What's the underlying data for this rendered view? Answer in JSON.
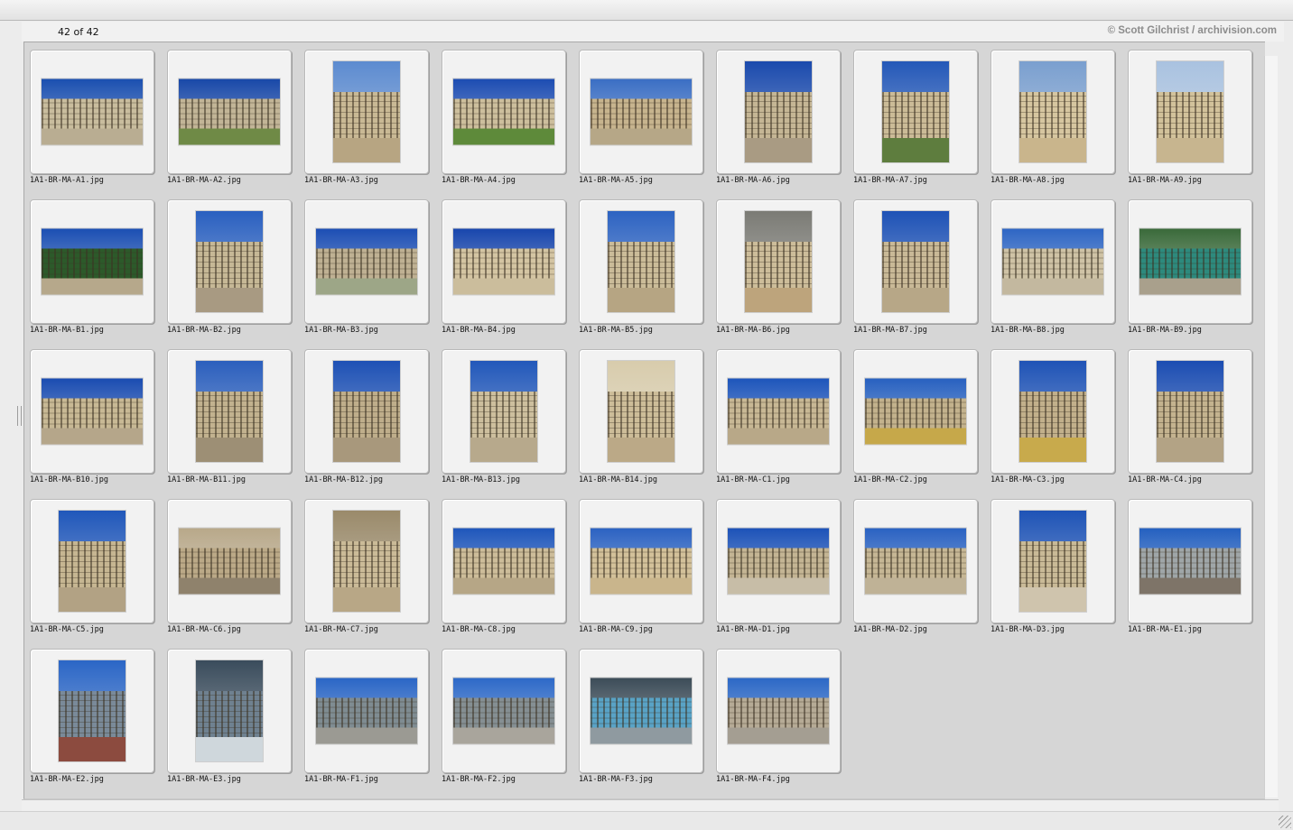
{
  "header": {
    "count_label": "42 of 42",
    "credit": "© Scott Gilchrist / archivision.com"
  },
  "files": [
    {
      "name": "1A1-BR-MA-A1.jpg",
      "orientation": "landscape",
      "palette": {
        "sky": "#1a4fb0",
        "building": "#c9bd9e",
        "ground": "#b9ad92"
      }
    },
    {
      "name": "1A1-BR-MA-A2.jpg",
      "orientation": "landscape",
      "palette": {
        "sky": "#1848a8",
        "building": "#c2b597",
        "ground": "#6f8a46"
      }
    },
    {
      "name": "1A1-BR-MA-A3.jpg",
      "orientation": "portrait",
      "palette": {
        "sky": "#5c8bd0",
        "building": "#c9b995",
        "ground": "#b7a582"
      }
    },
    {
      "name": "1A1-BR-MA-A4.jpg",
      "orientation": "landscape",
      "palette": {
        "sky": "#1c4cb2",
        "building": "#cdbf9d",
        "ground": "#5e8a3a"
      }
    },
    {
      "name": "1A1-BR-MA-A5.jpg",
      "orientation": "landscape",
      "palette": {
        "sky": "#3a6ec4",
        "building": "#c7b48e",
        "ground": "#b6a787"
      }
    },
    {
      "name": "1A1-BR-MA-A6.jpg",
      "orientation": "portrait",
      "palette": {
        "sky": "#1a4aad",
        "building": "#c5b695",
        "ground": "#a99b83"
      }
    },
    {
      "name": "1A1-BR-MA-A7.jpg",
      "orientation": "portrait",
      "palette": {
        "sky": "#2458b8",
        "building": "#cbbb97",
        "ground": "#5e7d3e"
      }
    },
    {
      "name": "1A1-BR-MA-A8.jpg",
      "orientation": "portrait",
      "palette": {
        "sky": "#7a9fcf",
        "building": "#d6c6a0",
        "ground": "#c9b58c"
      }
    },
    {
      "name": "1A1-BR-MA-A9.jpg",
      "orientation": "portrait",
      "palette": {
        "sky": "#a9c2e0",
        "building": "#d2c29b",
        "ground": "#c7b58f"
      }
    },
    {
      "name": "1A1-BR-MA-B1.jpg",
      "orientation": "landscape",
      "palette": {
        "sky": "#1b4fb3",
        "building": "#2c5a2a",
        "ground": "#b6a88b"
      }
    },
    {
      "name": "1A1-BR-MA-B2.jpg",
      "orientation": "portrait",
      "palette": {
        "sky": "#2a60c0",
        "building": "#c6b896",
        "ground": "#a89a82"
      }
    },
    {
      "name": "1A1-BR-MA-B3.jpg",
      "orientation": "landscape",
      "palette": {
        "sky": "#1c4eb4",
        "building": "#bfb193",
        "ground": "#9da687"
      }
    },
    {
      "name": "1A1-BR-MA-B4.jpg",
      "orientation": "landscape",
      "palette": {
        "sky": "#1846ad",
        "building": "#d4c5a3",
        "ground": "#cbbd9c"
      }
    },
    {
      "name": "1A1-BR-MA-B5.jpg",
      "orientation": "portrait",
      "palette": {
        "sky": "#2d63c2",
        "building": "#cbbc99",
        "ground": "#b6a583"
      }
    },
    {
      "name": "1A1-BR-MA-B6.jpg",
      "orientation": "portrait",
      "palette": {
        "sky": "#7b7b75",
        "building": "#cdbd9a",
        "ground": "#bda47c"
      }
    },
    {
      "name": "1A1-BR-MA-B7.jpg",
      "orientation": "portrait",
      "palette": {
        "sky": "#1e52b6",
        "building": "#c9b997",
        "ground": "#b7a787"
      }
    },
    {
      "name": "1A1-BR-MA-B8.jpg",
      "orientation": "landscape",
      "palette": {
        "sky": "#2e66c4",
        "building": "#cfc3a6",
        "ground": "#c3b89f"
      }
    },
    {
      "name": "1A1-BR-MA-B9.jpg",
      "orientation": "landscape",
      "palette": {
        "sky": "#3a6a3a",
        "building": "#2d8a7d",
        "ground": "#a9a08c"
      }
    },
    {
      "name": "1A1-BR-MA-B10.jpg",
      "orientation": "landscape",
      "palette": {
        "sky": "#1a4cb1",
        "building": "#c8b995",
        "ground": "#b5a68a"
      }
    },
    {
      "name": "1A1-BR-MA-B11.jpg",
      "orientation": "portrait",
      "palette": {
        "sky": "#2b5fbd",
        "building": "#c2b28f",
        "ground": "#9d8f75"
      }
    },
    {
      "name": "1A1-BR-MA-B12.jpg",
      "orientation": "portrait",
      "palette": {
        "sky": "#1e51b5",
        "building": "#bfae8b",
        "ground": "#a8987c"
      }
    },
    {
      "name": "1A1-BR-MA-B13.jpg",
      "orientation": "portrait",
      "palette": {
        "sky": "#2258ba",
        "building": "#cdbf9e",
        "ground": "#b7a98c"
      }
    },
    {
      "name": "1A1-BR-MA-B14.jpg",
      "orientation": "portrait",
      "palette": {
        "sky": "#d8ccac",
        "building": "#cdbd99",
        "ground": "#bba987"
      }
    },
    {
      "name": "1A1-BR-MA-C1.jpg",
      "orientation": "landscape",
      "palette": {
        "sky": "#1d55bb",
        "building": "#c8b895",
        "ground": "#b8a888"
      }
    },
    {
      "name": "1A1-BR-MA-C2.jpg",
      "orientation": "landscape",
      "palette": {
        "sky": "#2861c0",
        "building": "#c3b28d",
        "ground": "#c6a84a"
      }
    },
    {
      "name": "1A1-BR-MA-C3.jpg",
      "orientation": "portrait",
      "palette": {
        "sky": "#1f53b6",
        "building": "#c2b08b",
        "ground": "#c8aa4c"
      }
    },
    {
      "name": "1A1-BR-MA-C4.jpg",
      "orientation": "portrait",
      "palette": {
        "sky": "#1b4db2",
        "building": "#c4b38f",
        "ground": "#b3a385"
      }
    },
    {
      "name": "1A1-BR-MA-C5.jpg",
      "orientation": "portrait",
      "palette": {
        "sky": "#2057ba",
        "building": "#c6b692",
        "ground": "#b2a284"
      }
    },
    {
      "name": "1A1-BR-MA-C6.jpg",
      "orientation": "landscape",
      "palette": {
        "sky": "#b8a889",
        "building": "#bba987",
        "ground": "#8f826c"
      }
    },
    {
      "name": "1A1-BR-MA-C7.jpg",
      "orientation": "portrait",
      "palette": {
        "sky": "#9a8a6a",
        "building": "#cbbb98",
        "ground": "#b8a786"
      }
    },
    {
      "name": "1A1-BR-MA-C8.jpg",
      "orientation": "landscape",
      "palette": {
        "sky": "#1e56bb",
        "building": "#cdbd9a",
        "ground": "#b6a686"
      }
    },
    {
      "name": "1A1-BR-MA-C9.jpg",
      "orientation": "landscape",
      "palette": {
        "sky": "#2b62c2",
        "building": "#d3c19a",
        "ground": "#c9b58c"
      }
    },
    {
      "name": "1A1-BR-MA-D1.jpg",
      "orientation": "landscape",
      "palette": {
        "sky": "#1c52b8",
        "building": "#c4b594",
        "ground": "#c7bda7"
      }
    },
    {
      "name": "1A1-BR-MA-D2.jpg",
      "orientation": "landscape",
      "palette": {
        "sky": "#2a62c2",
        "building": "#c6b795",
        "ground": "#bfb296"
      }
    },
    {
      "name": "1A1-BR-MA-D3.jpg",
      "orientation": "portrait",
      "palette": {
        "sky": "#1e53b6",
        "building": "#c9ba97",
        "ground": "#cfc4ad"
      }
    },
    {
      "name": "1A1-BR-MA-E1.jpg",
      "orientation": "landscape",
      "palette": {
        "sky": "#2460c0",
        "building": "#9fa6a8",
        "ground": "#7e7468"
      }
    },
    {
      "name": "1A1-BR-MA-E2.jpg",
      "orientation": "portrait",
      "palette": {
        "sky": "#2b66c6",
        "building": "#7a8a99",
        "ground": "#8c4b3f"
      }
    },
    {
      "name": "1A1-BR-MA-E3.jpg",
      "orientation": "portrait",
      "palette": {
        "sky": "#3a4c5c",
        "building": "#6f8190",
        "ground": "#cfd7dc"
      }
    },
    {
      "name": "1A1-BR-MA-F1.jpg",
      "orientation": "landscape",
      "palette": {
        "sky": "#2a66c6",
        "building": "#7f8c92",
        "ground": "#9b9a93"
      }
    },
    {
      "name": "1A1-BR-MA-F2.jpg",
      "orientation": "landscape",
      "palette": {
        "sky": "#2d69c8",
        "building": "#858f93",
        "ground": "#a9a59c"
      }
    },
    {
      "name": "1A1-BR-MA-F3.jpg",
      "orientation": "landscape",
      "palette": {
        "sky": "#3c4c58",
        "building": "#59a3c6",
        "ground": "#8f9aa0"
      }
    },
    {
      "name": "1A1-BR-MA-F4.jpg",
      "orientation": "landscape",
      "palette": {
        "sky": "#2c68c6",
        "building": "#b6ab96",
        "ground": "#a49e92"
      }
    }
  ]
}
